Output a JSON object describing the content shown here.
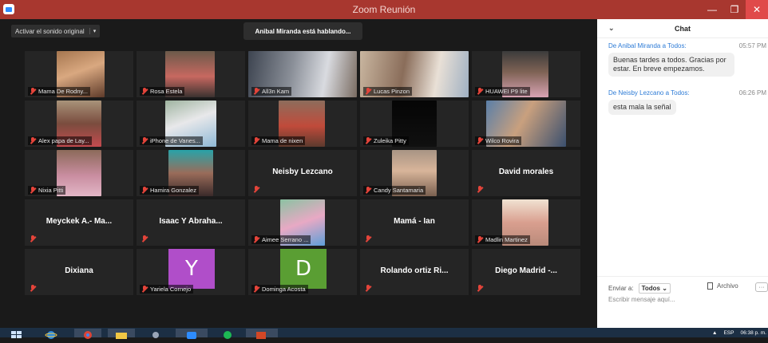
{
  "window": {
    "title": "Zoom Reunión",
    "min_glyph": "—",
    "max_glyph": "❐",
    "close_glyph": "✕"
  },
  "toolbar": {
    "unmute_label": "Activar el sonido original",
    "unmute_caret": "▾"
  },
  "speaker_banner": "Anibal Miranda está hablando...",
  "tiles": [
    {
      "name": "Mama De Rodny...",
      "type": "video"
    },
    {
      "name": "Rosa Estela",
      "type": "video"
    },
    {
      "name": "All3n Kam",
      "type": "video"
    },
    {
      "name": "Lucas Pinzon",
      "type": "video"
    },
    {
      "name": "HUAWEI P9 lite",
      "type": "video"
    },
    {
      "name": "Alex papa de Lay...",
      "type": "video"
    },
    {
      "name": "iPhone de Vanes...",
      "type": "video"
    },
    {
      "name": "Mama de nixen",
      "type": "video"
    },
    {
      "name": "Zuleika Pitty",
      "type": "video"
    },
    {
      "name": "Wilco Rovira",
      "type": "video"
    },
    {
      "name": "Nixia Pitti",
      "type": "video"
    },
    {
      "name": "Hamira Gonzalez",
      "type": "video"
    },
    {
      "name": "Neisby Lezcano",
      "type": "name"
    },
    {
      "name": "Candy Santamaria",
      "type": "video"
    },
    {
      "name": "David morales",
      "type": "name"
    },
    {
      "name": "Meyckek A.- Ma...",
      "type": "name"
    },
    {
      "name": "Isaac Y Abraha...",
      "type": "name"
    },
    {
      "name": "Aimee Serrano ...",
      "type": "video"
    },
    {
      "name": "Mamá - Ian",
      "type": "name"
    },
    {
      "name": "Madlin Martinez",
      "type": "video"
    },
    {
      "name": "Dixiana",
      "type": "name"
    },
    {
      "name": "Yariela Cornejo",
      "type": "letter",
      "letter": "Y",
      "color": "#b04ec9"
    },
    {
      "name": "Dominga Acosta",
      "type": "letter",
      "letter": "D",
      "color": "#5a9e33"
    },
    {
      "name": "Rolando ortiz Ri...",
      "type": "name"
    },
    {
      "name": "Diego Madrid -...",
      "type": "name"
    }
  ],
  "chat": {
    "title": "Chat",
    "collapse_glyph": "⌄",
    "messages": [
      {
        "header": "De Anibal Miranda a Todos:",
        "time": "05:57 PM",
        "text": "Buenas tardes a todos. Gracias por estar. En breve empezamos."
      },
      {
        "header": "De Neisby Lezcano a Todos:",
        "time": "06:26 PM",
        "text": "esta mala la señal"
      }
    ],
    "send_to_label": "Enviar a:",
    "send_to_value": "Todos ⌄",
    "file_label": "Archivo",
    "more_label": "···",
    "input_placeholder": "Escribir mensaje aquí..."
  },
  "taskbar": {
    "lang": "ESP",
    "clock": "06:38 p. m.",
    "tray_arrow": "▲"
  },
  "colors": {
    "titlebar": "#a8372f",
    "accent": "#2d7bd6",
    "muted_red": "#e4443a"
  }
}
